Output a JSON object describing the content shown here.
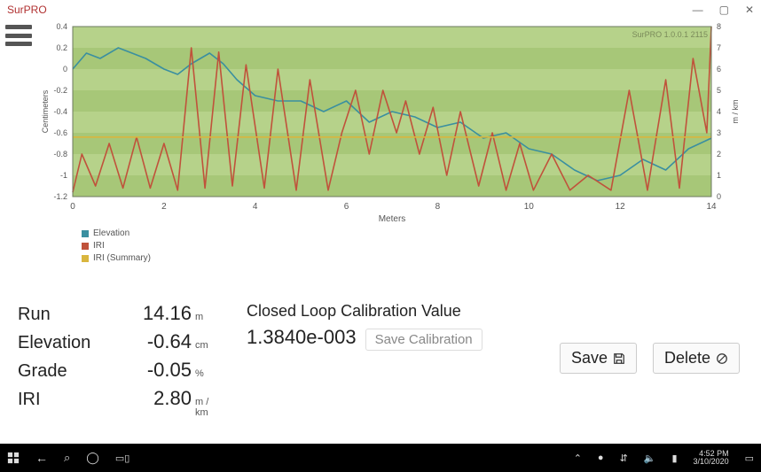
{
  "window": {
    "title": "SurPRO",
    "minimize": "—",
    "restore": "▢",
    "close": "✕"
  },
  "chart_data": {
    "type": "line",
    "title": "",
    "xlabel": "Meters",
    "ylabel_left": "Centimeters",
    "ylabel_right": "m / km",
    "xlim": [
      0,
      14
    ],
    "ylim_left": [
      -1.2,
      0.4
    ],
    "ylim_right": [
      0,
      8
    ],
    "x_ticks": [
      0,
      2,
      4,
      6,
      8,
      10,
      12,
      14
    ],
    "y_ticks_left": [
      -1.2,
      -1.0,
      -0.8,
      -0.6,
      -0.4,
      -0.2,
      0,
      0.2,
      0.4
    ],
    "y_ticks_right": [
      0,
      1,
      2,
      3,
      4,
      5,
      6,
      7,
      8
    ],
    "watermark": "SurPRO 1.0.0.1 2115",
    "legend": [
      {
        "name": "Elevation",
        "color": "#3a8fa0"
      },
      {
        "name": "IRI",
        "color": "#c0523b"
      },
      {
        "name": "IRI (Summary)",
        "color": "#d9b63e"
      }
    ],
    "series": [
      {
        "name": "Elevation",
        "axis": "left",
        "color": "#3a8fa0",
        "x": [
          0,
          0.3,
          0.6,
          1,
          1.3,
          1.6,
          2,
          2.3,
          2.6,
          3,
          3.3,
          3.6,
          4,
          4.5,
          5,
          5.5,
          6,
          6.5,
          7,
          7.5,
          8,
          8.5,
          9,
          9.5,
          10,
          10.5,
          11,
          11.5,
          12,
          12.5,
          13,
          13.5,
          14
        ],
        "values": [
          0.0,
          0.15,
          0.1,
          0.2,
          0.15,
          0.1,
          0.0,
          -0.05,
          0.05,
          0.15,
          0.05,
          -0.1,
          -0.25,
          -0.3,
          -0.3,
          -0.4,
          -0.3,
          -0.5,
          -0.4,
          -0.45,
          -0.55,
          -0.5,
          -0.65,
          -0.6,
          -0.75,
          -0.8,
          -0.95,
          -1.05,
          -1.0,
          -0.85,
          -0.95,
          -0.75,
          -0.65
        ]
      },
      {
        "name": "IRI",
        "axis": "right",
        "color": "#c0523b",
        "x": [
          0,
          0.2,
          0.5,
          0.8,
          1.1,
          1.4,
          1.7,
          2.0,
          2.3,
          2.6,
          2.9,
          3.2,
          3.5,
          3.8,
          4.2,
          4.5,
          4.9,
          5.2,
          5.6,
          5.9,
          6.2,
          6.5,
          6.8,
          7.1,
          7.3,
          7.6,
          7.9,
          8.2,
          8.5,
          8.9,
          9.2,
          9.5,
          9.8,
          10.1,
          10.5,
          10.9,
          11.3,
          11.8,
          12.2,
          12.6,
          13.0,
          13.3,
          13.6,
          13.9,
          14.0
        ],
        "values": [
          0.2,
          2.0,
          0.5,
          2.5,
          0.4,
          2.8,
          0.4,
          2.5,
          0.3,
          7.0,
          0.4,
          6.8,
          0.5,
          6.2,
          0.4,
          6.0,
          0.3,
          5.5,
          0.3,
          3.0,
          5.0,
          2.0,
          5.0,
          3.0,
          4.5,
          2.0,
          4.2,
          1.0,
          4.0,
          0.5,
          3.0,
          0.3,
          2.5,
          0.3,
          2.0,
          0.3,
          1.0,
          0.3,
          5.0,
          0.3,
          5.5,
          0.4,
          6.5,
          3.0,
          8.0
        ]
      },
      {
        "name": "IRI (Summary)",
        "axis": "right",
        "color": "#d9b63e",
        "x": [
          0,
          14
        ],
        "values": [
          2.8,
          2.8
        ]
      }
    ]
  },
  "stats": {
    "run": {
      "label": "Run",
      "value": "14.16",
      "unit": "m"
    },
    "elevation": {
      "label": "Elevation",
      "value": "-0.64",
      "unit": "cm"
    },
    "grade": {
      "label": "Grade",
      "value": "-0.05",
      "unit": "%"
    },
    "iri": {
      "label": "IRI",
      "value": "2.80",
      "unit": "m / km"
    }
  },
  "calibration": {
    "title": "Closed Loop Calibration Value",
    "value": "1.3840e-003",
    "save_label": "Save Calibration"
  },
  "actions": {
    "save": "Save",
    "delete": "Delete"
  },
  "taskbar": {
    "time": "4:52 PM",
    "date": "3/10/2020"
  },
  "colors": {
    "plot_bg": "#b6d28a",
    "plot_band": "#a7c778",
    "axis": "#6c7a60"
  }
}
